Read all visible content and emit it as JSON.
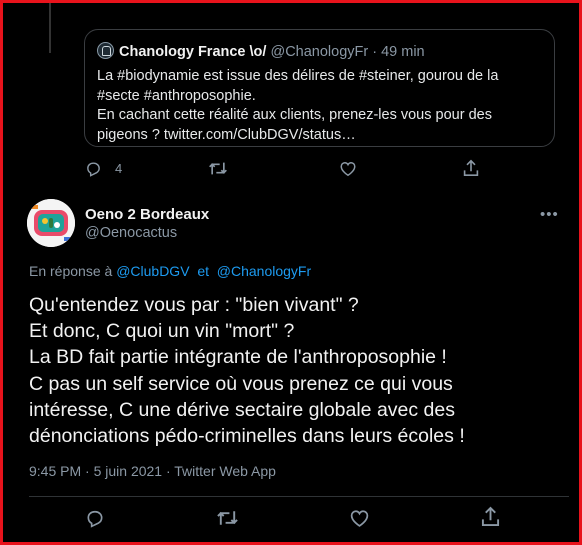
{
  "quoted_tweet": {
    "name": "Chanology France \\o/",
    "handle": "@ChanologyFr",
    "time": "· 49 min",
    "lines": [
      "La #biodynamie est issue des délires de #steiner, gourou de la",
      "#secte #anthroposophie.",
      "En cachant cette réalité aux clients, prenez-les vous pour des",
      "pigeons ? twitter.com/ClubDGV/status…"
    ],
    "reply_count": "4"
  },
  "tweet": {
    "author_name": "Oeno 2 Bordeaux",
    "author_handle": "@Oenocactus",
    "reply_prefix": "En réponse à",
    "mention_1": "@ClubDGV",
    "and_word": "et",
    "mention_2": "@ChanologyFr",
    "lines": [
      "Qu'entendez vous par : \"bien vivant\" ?",
      "Et donc, C quoi un vin \"mort\" ?",
      "La BD fait partie intégrante de l'anthroposophie !",
      "C pas un self service où vous prenez ce qui vous",
      "intéresse, C une dérive sectaire globale avec des",
      "dénonciations pédo-criminelles dans leurs écoles !"
    ],
    "meta": "9:45 PM · 5 juin 2021 · Twitter Web App",
    "more": "•••"
  },
  "colors": {
    "frame_border": "#e8131c",
    "background": "#000000",
    "accent_link": "#1d9bf0",
    "secondary_text": "#8b98a5"
  },
  "icons": [
    "reply-icon",
    "retweet-icon",
    "like-icon",
    "share-icon",
    "more-icon"
  ]
}
